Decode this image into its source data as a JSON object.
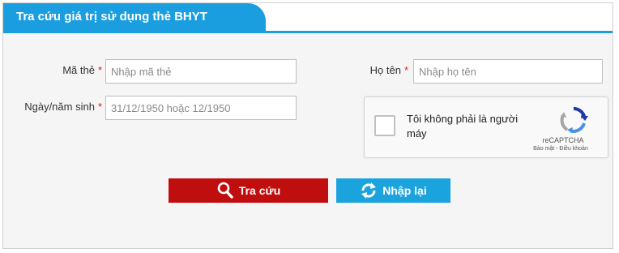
{
  "header": {
    "title": "Tra cứu giá trị sử dụng thẻ BHYT"
  },
  "form": {
    "card_number": {
      "label": "Mã thẻ",
      "required_mark": "*",
      "placeholder": "Nhập mã thẻ",
      "value": ""
    },
    "full_name": {
      "label": "Họ tên",
      "required_mark": "*",
      "placeholder": "Nhập họ tên",
      "value": ""
    },
    "birth_date": {
      "label": "Ngày/năm sinh",
      "required_mark": "*",
      "placeholder": "31/12/1950 hoặc 12/1950",
      "value": ""
    }
  },
  "captcha": {
    "checkbox_label": "Tôi không phải là người máy",
    "brand": "reCAPTCHA",
    "links": "Bảo mật - Điều khoản",
    "checked": false
  },
  "buttons": {
    "search_label": "Tra cứu",
    "reset_label": "Nhập lại"
  },
  "colors": {
    "accent": "#1a9ee0",
    "search_button": "#c00d0d",
    "reset_button": "#1aa3dd",
    "required": "#d42020"
  },
  "icons": {
    "search": "magnifier-icon",
    "reset": "refresh-icon",
    "captcha": "recaptcha-logo-icon"
  }
}
